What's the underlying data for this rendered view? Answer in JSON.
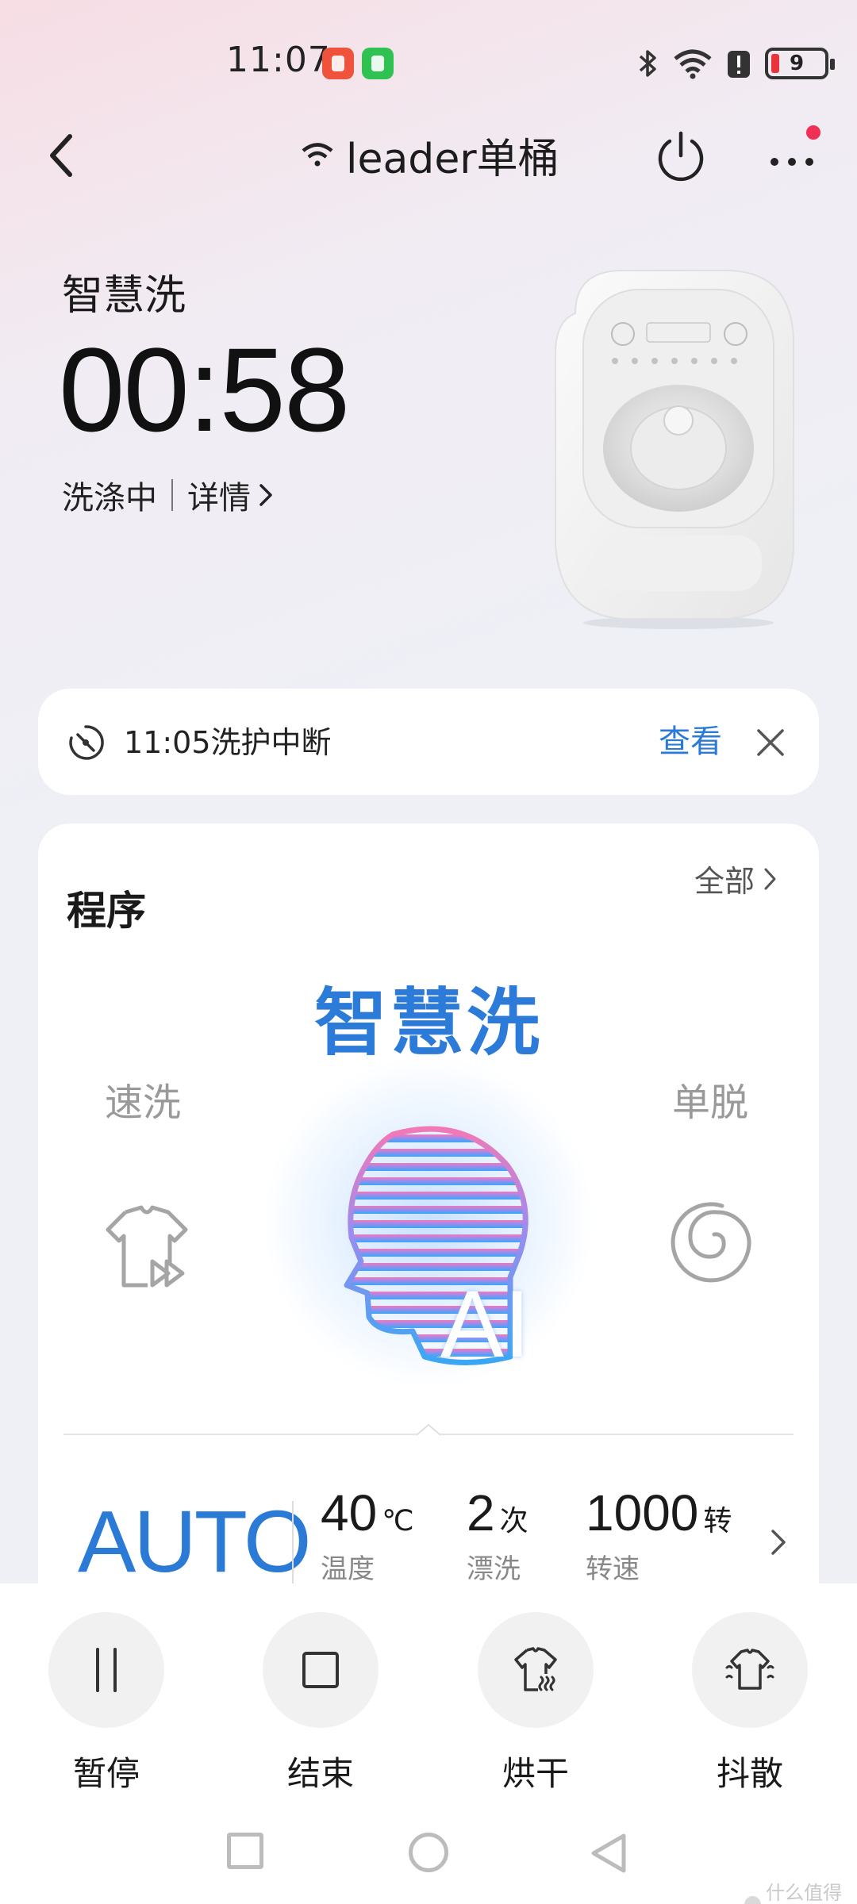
{
  "status_bar": {
    "time": "11:07",
    "battery_level": "9",
    "icons": [
      "bluetooth-icon",
      "wifi-icon",
      "alert-icon",
      "battery-icon"
    ]
  },
  "header": {
    "device_name": "leader单桶"
  },
  "hero": {
    "mode": "智慧洗",
    "remaining_time": "00:58",
    "state": "洗涤中",
    "details": "详情"
  },
  "notice": {
    "text": "11:05洗护中断",
    "action": "查看"
  },
  "program": {
    "title": "程序",
    "all_label": "全部",
    "current": "智慧洗",
    "left_option": "速洗",
    "right_option": "单脱",
    "ai_text": "AI",
    "mode_label": "AUTO",
    "params": [
      {
        "value": "40",
        "unit": "℃",
        "label": "温度"
      },
      {
        "value": "2",
        "unit": "次",
        "label": "漂洗"
      },
      {
        "value": "1000",
        "unit": "转",
        "label": "转速"
      }
    ]
  },
  "actions": [
    {
      "label": "暂停"
    },
    {
      "label": "结束"
    },
    {
      "label": "烘干"
    },
    {
      "label": "抖散"
    }
  ],
  "watermark": "什么值得买",
  "colors": {
    "accent": "#2a7ad6",
    "badge": "#ef2f55"
  }
}
